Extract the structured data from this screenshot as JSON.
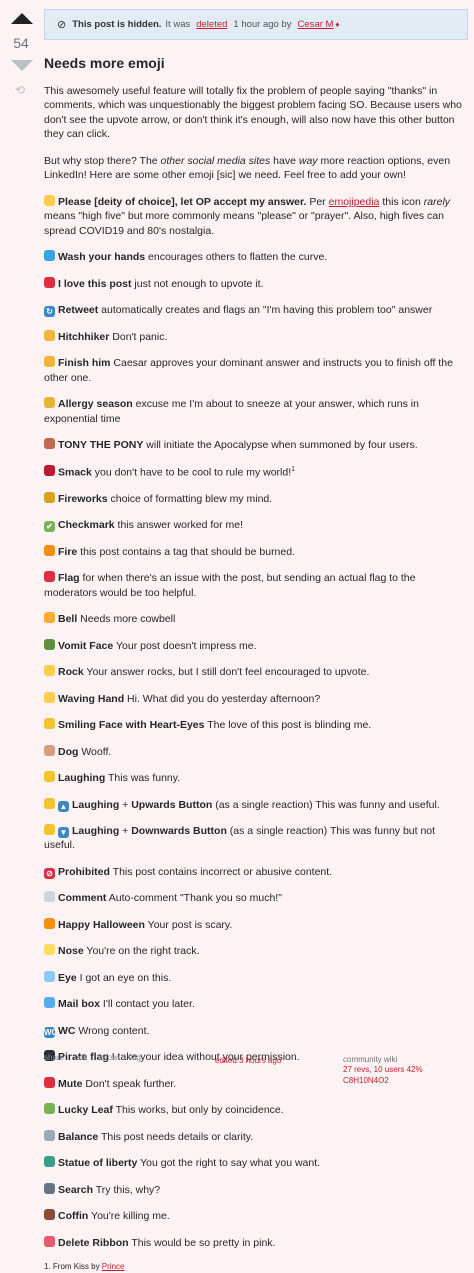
{
  "vote": {
    "count": "54"
  },
  "notice": {
    "strong": "This post is hidden.",
    "text1": "It was",
    "link": "deleted",
    "text2": "1 hour ago by",
    "user": "Cesar M",
    "mod_badge": "♦"
  },
  "title": "Needs more emoji",
  "intro": {
    "p1": "This awesomely useful feature will totally fix the problem of people saying \"thanks\" in comments, which was unquestionably the biggest problem facing SO. Because users who don't see the upvote arrow, or don't think it's enough, will also now have this other button they can click.",
    "p2_a": "But why stop there? The ",
    "p2_em1": "other social media sites",
    "p2_b": " have ",
    "p2_em2": "way",
    "p2_c": " more reaction options, even LinkedIn! Here are some other emoji [sic] we need. Feel free to add your own!"
  },
  "pray": {
    "name": "Please [deity of choice], let OP accept my answer.",
    "a": " Per ",
    "link": "emojipedia",
    "b": " this icon ",
    "em": "rarely",
    "c": " means \"high five\" but more commonly means \"please\" or \"prayer\". Also, high fives can spread COVID19 and 80's nostalgia."
  },
  "items": [
    {
      "icon": "soap-icon",
      "color": "#3aa3e3",
      "glyph": "",
      "name": "Wash your hands",
      "desc": " encourages others to flatten the curve."
    },
    {
      "icon": "heart-icon",
      "color": "#dd2e44",
      "glyph": "",
      "name": "I love this post",
      "desc": " just not enough to upvote it."
    },
    {
      "icon": "retweet-icon",
      "color": "#3b88c3",
      "glyph": "↻",
      "name": "Retweet",
      "desc": " automatically creates and flags an \"I'm having this problem too\" answer"
    },
    {
      "icon": "thumbs-up-icon",
      "color": "#f2b43b",
      "glyph": "",
      "name": "Hitchhiker",
      "desc": " Don't panic."
    },
    {
      "icon": "thumbs-down-icon",
      "color": "#f2b43b",
      "glyph": "",
      "name": "Finish him",
      "desc": " Caesar approves your dominant answer and instructs you to finish off the other one."
    },
    {
      "icon": "sneezing-face-icon",
      "color": "#e8b437",
      "glyph": "",
      "name": "Allergy season",
      "desc": " excuse me I'm about to sneeze at your answer, which runs in exponential time"
    },
    {
      "icon": "horse-face-icon",
      "color": "#c1694f",
      "glyph": "",
      "name": "TONY THE PONY",
      "desc": " will initiate the Apocalypse when summoned by four users."
    },
    {
      "icon": "lips-icon",
      "color": "#be1931",
      "glyph": "",
      "name": "Smack",
      "desc": " you don't have to be cool to rule my world!",
      "sup": "1"
    },
    {
      "icon": "fireworks-icon",
      "color": "#d9a21c",
      "glyph": "",
      "name": "Fireworks",
      "desc": " choice of formatting blew my mind."
    },
    {
      "icon": "check-mark-icon",
      "color": "#77b255",
      "glyph": "✔",
      "name": "Checkmark",
      "desc": " this answer worked for me!"
    },
    {
      "icon": "fire-icon",
      "color": "#f4900c",
      "glyph": "",
      "name": "Fire",
      "desc": " this post contains a tag that should be burned."
    },
    {
      "icon": "red-flag-icon",
      "color": "#dd2e44",
      "glyph": "",
      "name": "Flag",
      "desc": " for when there's an issue with the post, but sending an actual flag to the moderators would be too helpful."
    },
    {
      "icon": "bell-icon",
      "color": "#ffac33",
      "glyph": "",
      "name": "Bell",
      "desc": " Needs more cowbell"
    },
    {
      "icon": "vomiting-face-icon",
      "color": "#5c913b",
      "glyph": "",
      "name": "Vomit Face",
      "desc": " Your post doesn't impress me."
    },
    {
      "icon": "sign-of-horns-icon",
      "color": "#ffcc4d",
      "glyph": "",
      "name": "Rock",
      "desc": " Your answer rocks, but I still don't feel encouraged to upvote."
    },
    {
      "icon": "waving-hand-icon",
      "color": "#ffcc4d",
      "glyph": "",
      "name": "Waving Hand",
      "desc": " Hi. What did you do yesterday afternoon?"
    },
    {
      "icon": "heart-eyes-icon",
      "color": "#f4c430",
      "glyph": "",
      "name": "Smiling Face with Heart-Eyes",
      "desc": " The love of this post is blinding me."
    },
    {
      "icon": "dog-icon",
      "color": "#d99e82",
      "glyph": "",
      "name": "Dog",
      "desc": " Wooff."
    },
    {
      "icon": "laughing-face-icon",
      "color": "#f4c430",
      "glyph": "",
      "name": "Laughing",
      "desc": " This was funny."
    }
  ],
  "combos": [
    {
      "icon1": "laughing-face-icon",
      "icon2": "up-button-icon",
      "glyph2": "▲",
      "name1": "Laughing",
      "plus": " + ",
      "name2": "Upwards Button",
      "desc": " (as a single reaction) This was funny and useful."
    },
    {
      "icon1": "laughing-face-icon",
      "icon2": "down-button-icon",
      "glyph2": "▼",
      "name1": "Laughing",
      "plus": " + ",
      "name2": "Downwards Button",
      "desc": " (as a single reaction) This was funny but not useful."
    }
  ],
  "items2": [
    {
      "icon": "prohibited-icon",
      "color": "#dd2e44",
      "glyph": "⊘",
      "name": "Prohibited",
      "desc": " This post contains incorrect or abusive content."
    },
    {
      "icon": "memo-icon",
      "color": "#ccd6dd",
      "glyph": "",
      "name": "Comment",
      "desc": " Auto-comment \"Thank you so much!\""
    },
    {
      "icon": "jack-o-lantern-icon",
      "color": "#f4900c",
      "glyph": "",
      "name": "Happy Halloween",
      "desc": " Your post is scary."
    },
    {
      "icon": "nose-icon",
      "color": "#ffdc5d",
      "glyph": "",
      "name": "Nose",
      "desc": " You're on the right track."
    },
    {
      "icon": "eye-icon",
      "color": "#88c9f9",
      "glyph": "",
      "name": "Eye",
      "desc": " I got an eye on this."
    },
    {
      "icon": "mailbox-icon",
      "color": "#55acee",
      "glyph": "",
      "name": "Mail box",
      "desc": " I'll contact you later."
    },
    {
      "icon": "wc-icon",
      "color": "#3b88c3",
      "glyph": "WC",
      "name": "WC",
      "desc": " Wrong content."
    },
    {
      "icon": "pirate-flag-icon",
      "color": "#292f33",
      "glyph": "",
      "name": "Pirate flag",
      "desc": " I take your idea without your permission."
    },
    {
      "icon": "muted-speaker-icon",
      "color": "#dd2e44",
      "glyph": "",
      "name": "Mute",
      "desc": " Don't speak further."
    },
    {
      "icon": "four-leaf-clover-icon",
      "color": "#77b255",
      "glyph": "",
      "name": "Lucky Leaf",
      "desc": " This works, but only by coincidence."
    },
    {
      "icon": "balance-scale-icon",
      "color": "#99aab5",
      "glyph": "",
      "name": "Balance",
      "desc": " This post needs details or clarity."
    },
    {
      "icon": "statue-of-liberty-icon",
      "color": "#3a9f8a",
      "glyph": "",
      "name": "Statue of liberty",
      "desc": " You got the right to say what you want."
    },
    {
      "icon": "magnifying-glass-icon",
      "color": "#66757f",
      "glyph": "",
      "name": "Search",
      "desc": " Try this, why?"
    },
    {
      "icon": "coffin-icon",
      "color": "#8a4b38",
      "glyph": "",
      "name": "Coffin",
      "desc": " You're killing me."
    },
    {
      "icon": "ribbon-icon",
      "color": "#ea596e",
      "glyph": "",
      "name": "Delete Ribbon",
      "desc": " This would be so pretty in pink."
    }
  ],
  "footnote": {
    "text": "1. From Kiss by ",
    "link": "Prince"
  },
  "menu": {
    "share": "share",
    "edit": "edit",
    "follow": "follow",
    "flag": "flag"
  },
  "edited": "edited 3 hours ago",
  "wiki": {
    "label": "community wiki",
    "revs": "27 revs, 10 users 42%",
    "user": "C8H10N4O2"
  }
}
